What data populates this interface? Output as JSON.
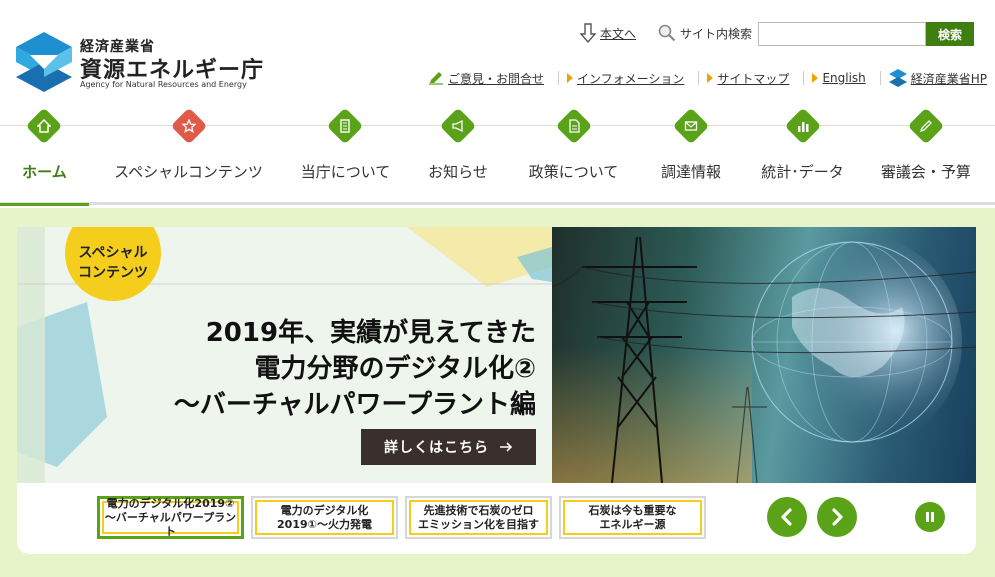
{
  "header": {
    "logo_small": "経済産業省",
    "logo_big": "資源エネルギー庁",
    "logo_en": "Agency for Natural Resources and Energy",
    "skip_link": "本文へ",
    "site_search_label": "サイト内検索",
    "search_placeholder": "",
    "search_button": "検索",
    "links": [
      {
        "label": "ご意見・お問合せ"
      },
      {
        "label": "インフォメーション"
      },
      {
        "label": "サイトマップ"
      },
      {
        "label": "English"
      },
      {
        "label": "経済産業省HP"
      }
    ]
  },
  "nav": {
    "items": [
      {
        "label": "ホーム",
        "icon": "home-icon"
      },
      {
        "label": "スペシャルコンテンツ",
        "icon": "star-icon"
      },
      {
        "label": "当庁について",
        "icon": "building-icon"
      },
      {
        "label": "お知らせ",
        "icon": "megaphone-icon"
      },
      {
        "label": "政策について",
        "icon": "document-icon"
      },
      {
        "label": "調達情報",
        "icon": "mail-icon"
      },
      {
        "label": "統計･データ",
        "icon": "bar-chart-icon"
      },
      {
        "label": "審議会・予算",
        "icon": "pencil-icon"
      }
    ],
    "active": "ホーム"
  },
  "slider": {
    "badge_line1": "スペシャル",
    "badge_line2": "コンテンツ",
    "title_line1": "2019年、実績が見えてきた",
    "title_line2": "電力分野のデジタル化②",
    "title_line3": "～バーチャルパワープラント編",
    "more_button": "詳しくはこちら",
    "thumbs": [
      {
        "line1": "電力のデジタル化2019②",
        "line2": "～バーチャルパワープラント"
      },
      {
        "line1": "電力のデジタル化",
        "line2": "2019①～火力発電"
      },
      {
        "line1": "先進技術で石炭のゼロ",
        "line2": "エミッション化を目指す"
      },
      {
        "line1": "石炭は今も重要な",
        "line2": "エネルギー源"
      }
    ],
    "active_thumb": 0
  },
  "colors": {
    "brand_green": "#5aa218",
    "dark_green": "#3f7f12",
    "accent_yellow": "#f5cd1d",
    "bg_light_green": "#e7f3c9",
    "logo_blue": "#1e8fd0"
  }
}
